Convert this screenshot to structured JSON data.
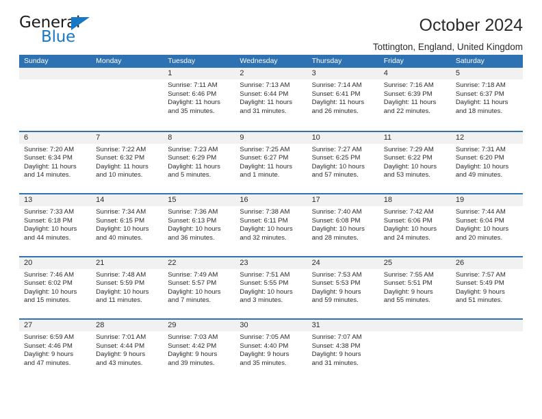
{
  "brand": {
    "word_one": "General",
    "word_two": "Blue",
    "triangle_icon": "triangle-icon",
    "blue": "#1878c4"
  },
  "header": {
    "title": "October 2024",
    "location": "Tottington, England, United Kingdom"
  },
  "colors": {
    "header_blue": "#2e72b3",
    "day_band_gray": "#f1f1f1",
    "text": "#2b2b2b"
  },
  "weekdays": [
    "Sunday",
    "Monday",
    "Tuesday",
    "Wednesday",
    "Thursday",
    "Friday",
    "Saturday"
  ],
  "labels": {
    "sunrise_prefix": "Sunrise: ",
    "sunset_prefix": "Sunset: ",
    "daylight_prefix": "Daylight: "
  },
  "weeks": [
    [
      {
        "day": "",
        "blank": true
      },
      {
        "day": "",
        "blank": true
      },
      {
        "day": "1",
        "sunrise": "Sunrise: 7:11 AM",
        "sunset": "Sunset: 6:46 PM",
        "daylight_1": "Daylight: 11 hours",
        "daylight_2": "and 35 minutes."
      },
      {
        "day": "2",
        "sunrise": "Sunrise: 7:13 AM",
        "sunset": "Sunset: 6:44 PM",
        "daylight_1": "Daylight: 11 hours",
        "daylight_2": "and 31 minutes."
      },
      {
        "day": "3",
        "sunrise": "Sunrise: 7:14 AM",
        "sunset": "Sunset: 6:41 PM",
        "daylight_1": "Daylight: 11 hours",
        "daylight_2": "and 26 minutes."
      },
      {
        "day": "4",
        "sunrise": "Sunrise: 7:16 AM",
        "sunset": "Sunset: 6:39 PM",
        "daylight_1": "Daylight: 11 hours",
        "daylight_2": "and 22 minutes."
      },
      {
        "day": "5",
        "sunrise": "Sunrise: 7:18 AM",
        "sunset": "Sunset: 6:37 PM",
        "daylight_1": "Daylight: 11 hours",
        "daylight_2": "and 18 minutes."
      }
    ],
    [
      {
        "day": "6",
        "sunrise": "Sunrise: 7:20 AM",
        "sunset": "Sunset: 6:34 PM",
        "daylight_1": "Daylight: 11 hours",
        "daylight_2": "and 14 minutes."
      },
      {
        "day": "7",
        "sunrise": "Sunrise: 7:22 AM",
        "sunset": "Sunset: 6:32 PM",
        "daylight_1": "Daylight: 11 hours",
        "daylight_2": "and 10 minutes."
      },
      {
        "day": "8",
        "sunrise": "Sunrise: 7:23 AM",
        "sunset": "Sunset: 6:29 PM",
        "daylight_1": "Daylight: 11 hours",
        "daylight_2": "and 5 minutes."
      },
      {
        "day": "9",
        "sunrise": "Sunrise: 7:25 AM",
        "sunset": "Sunset: 6:27 PM",
        "daylight_1": "Daylight: 11 hours",
        "daylight_2": "and 1 minute."
      },
      {
        "day": "10",
        "sunrise": "Sunrise: 7:27 AM",
        "sunset": "Sunset: 6:25 PM",
        "daylight_1": "Daylight: 10 hours",
        "daylight_2": "and 57 minutes."
      },
      {
        "day": "11",
        "sunrise": "Sunrise: 7:29 AM",
        "sunset": "Sunset: 6:22 PM",
        "daylight_1": "Daylight: 10 hours",
        "daylight_2": "and 53 minutes."
      },
      {
        "day": "12",
        "sunrise": "Sunrise: 7:31 AM",
        "sunset": "Sunset: 6:20 PM",
        "daylight_1": "Daylight: 10 hours",
        "daylight_2": "and 49 minutes."
      }
    ],
    [
      {
        "day": "13",
        "sunrise": "Sunrise: 7:33 AM",
        "sunset": "Sunset: 6:18 PM",
        "daylight_1": "Daylight: 10 hours",
        "daylight_2": "and 44 minutes."
      },
      {
        "day": "14",
        "sunrise": "Sunrise: 7:34 AM",
        "sunset": "Sunset: 6:15 PM",
        "daylight_1": "Daylight: 10 hours",
        "daylight_2": "and 40 minutes."
      },
      {
        "day": "15",
        "sunrise": "Sunrise: 7:36 AM",
        "sunset": "Sunset: 6:13 PM",
        "daylight_1": "Daylight: 10 hours",
        "daylight_2": "and 36 minutes."
      },
      {
        "day": "16",
        "sunrise": "Sunrise: 7:38 AM",
        "sunset": "Sunset: 6:11 PM",
        "daylight_1": "Daylight: 10 hours",
        "daylight_2": "and 32 minutes."
      },
      {
        "day": "17",
        "sunrise": "Sunrise: 7:40 AM",
        "sunset": "Sunset: 6:08 PM",
        "daylight_1": "Daylight: 10 hours",
        "daylight_2": "and 28 minutes."
      },
      {
        "day": "18",
        "sunrise": "Sunrise: 7:42 AM",
        "sunset": "Sunset: 6:06 PM",
        "daylight_1": "Daylight: 10 hours",
        "daylight_2": "and 24 minutes."
      },
      {
        "day": "19",
        "sunrise": "Sunrise: 7:44 AM",
        "sunset": "Sunset: 6:04 PM",
        "daylight_1": "Daylight: 10 hours",
        "daylight_2": "and 20 minutes."
      }
    ],
    [
      {
        "day": "20",
        "sunrise": "Sunrise: 7:46 AM",
        "sunset": "Sunset: 6:02 PM",
        "daylight_1": "Daylight: 10 hours",
        "daylight_2": "and 15 minutes."
      },
      {
        "day": "21",
        "sunrise": "Sunrise: 7:48 AM",
        "sunset": "Sunset: 5:59 PM",
        "daylight_1": "Daylight: 10 hours",
        "daylight_2": "and 11 minutes."
      },
      {
        "day": "22",
        "sunrise": "Sunrise: 7:49 AM",
        "sunset": "Sunset: 5:57 PM",
        "daylight_1": "Daylight: 10 hours",
        "daylight_2": "and 7 minutes."
      },
      {
        "day": "23",
        "sunrise": "Sunrise: 7:51 AM",
        "sunset": "Sunset: 5:55 PM",
        "daylight_1": "Daylight: 10 hours",
        "daylight_2": "and 3 minutes."
      },
      {
        "day": "24",
        "sunrise": "Sunrise: 7:53 AM",
        "sunset": "Sunset: 5:53 PM",
        "daylight_1": "Daylight: 9 hours",
        "daylight_2": "and 59 minutes."
      },
      {
        "day": "25",
        "sunrise": "Sunrise: 7:55 AM",
        "sunset": "Sunset: 5:51 PM",
        "daylight_1": "Daylight: 9 hours",
        "daylight_2": "and 55 minutes."
      },
      {
        "day": "26",
        "sunrise": "Sunrise: 7:57 AM",
        "sunset": "Sunset: 5:49 PM",
        "daylight_1": "Daylight: 9 hours",
        "daylight_2": "and 51 minutes."
      }
    ],
    [
      {
        "day": "27",
        "sunrise": "Sunrise: 6:59 AM",
        "sunset": "Sunset: 4:46 PM",
        "daylight_1": "Daylight: 9 hours",
        "daylight_2": "and 47 minutes."
      },
      {
        "day": "28",
        "sunrise": "Sunrise: 7:01 AM",
        "sunset": "Sunset: 4:44 PM",
        "daylight_1": "Daylight: 9 hours",
        "daylight_2": "and 43 minutes."
      },
      {
        "day": "29",
        "sunrise": "Sunrise: 7:03 AM",
        "sunset": "Sunset: 4:42 PM",
        "daylight_1": "Daylight: 9 hours",
        "daylight_2": "and 39 minutes."
      },
      {
        "day": "30",
        "sunrise": "Sunrise: 7:05 AM",
        "sunset": "Sunset: 4:40 PM",
        "daylight_1": "Daylight: 9 hours",
        "daylight_2": "and 35 minutes."
      },
      {
        "day": "31",
        "sunrise": "Sunrise: 7:07 AM",
        "sunset": "Sunset: 4:38 PM",
        "daylight_1": "Daylight: 9 hours",
        "daylight_2": "and 31 minutes."
      },
      {
        "day": "",
        "blank": true
      },
      {
        "day": "",
        "blank": true
      }
    ]
  ]
}
